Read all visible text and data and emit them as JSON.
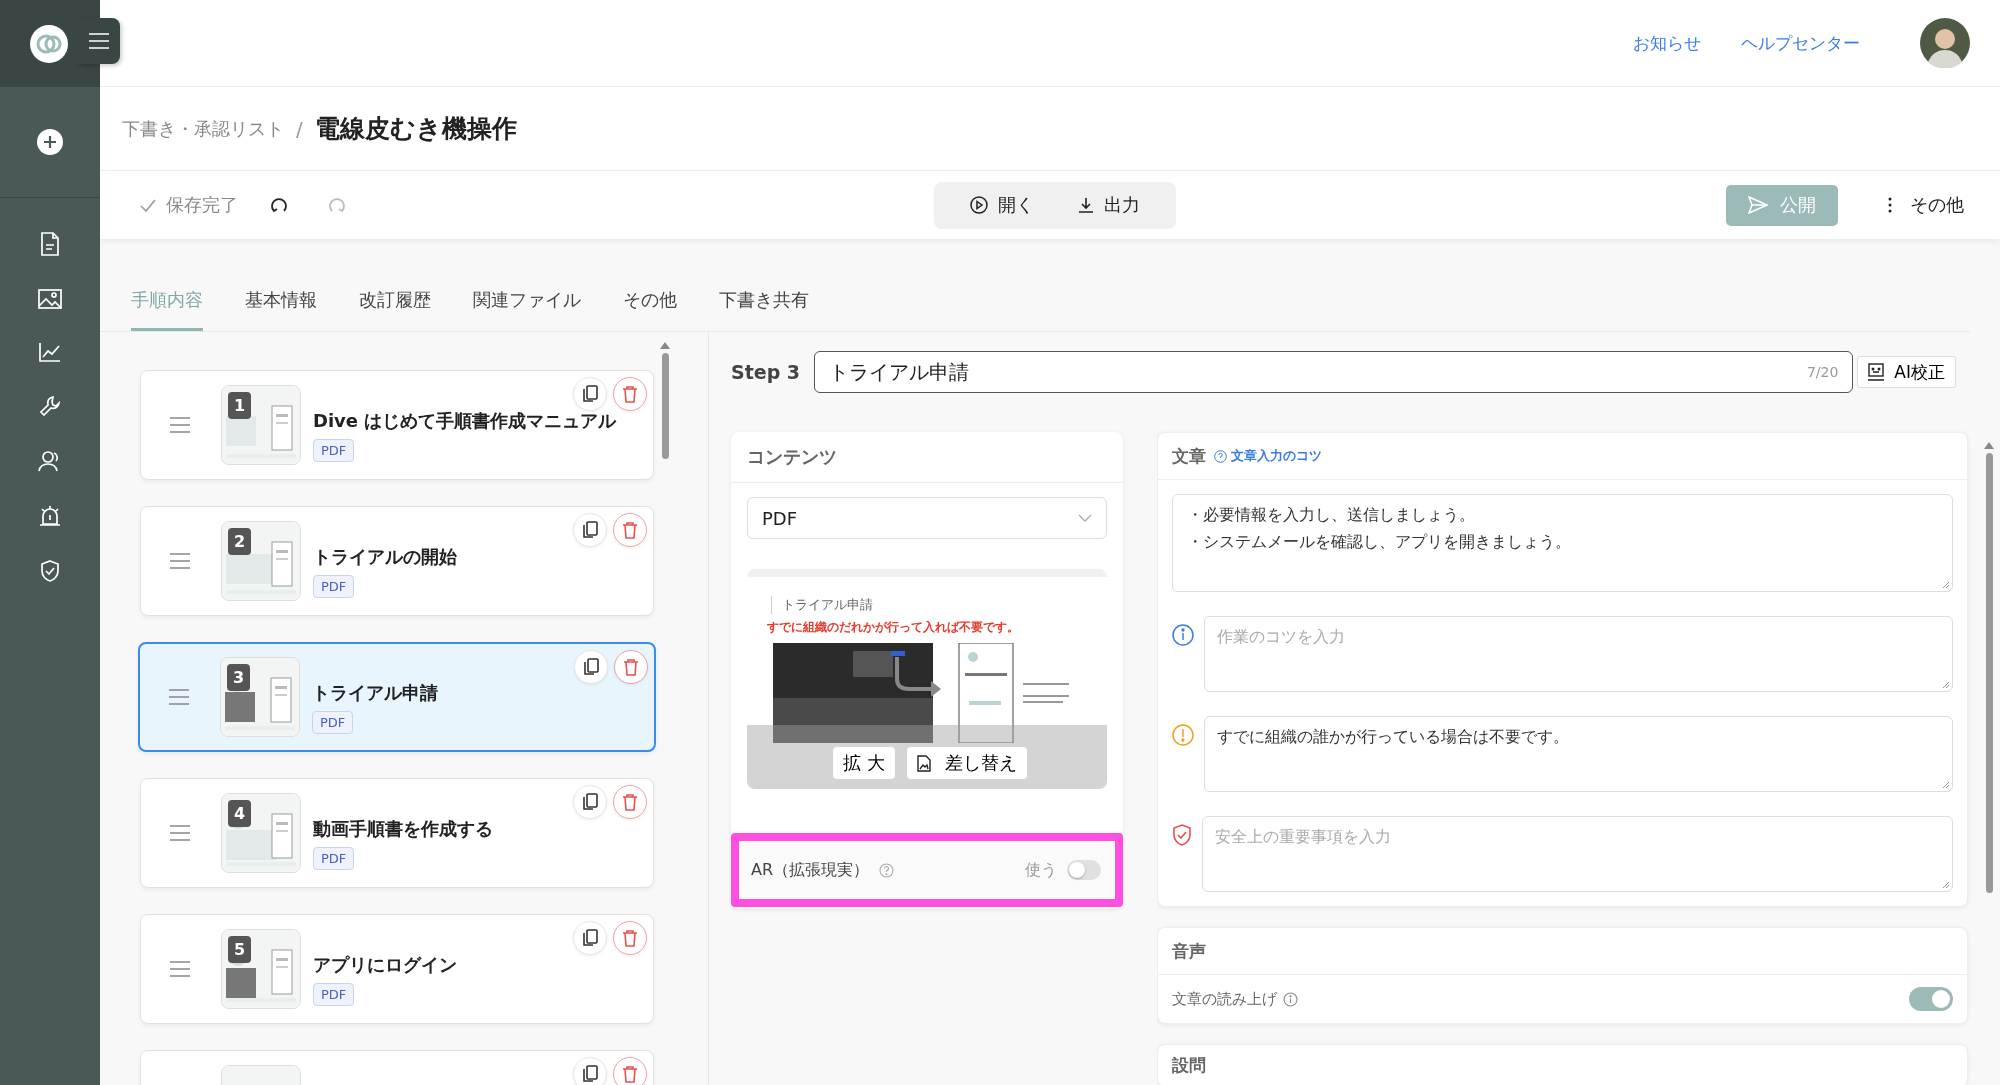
{
  "header": {
    "links": [
      "お知らせ",
      "ヘルプセンター"
    ]
  },
  "breadcrumb": {
    "parent": "下書き・承認リスト",
    "separator": "/",
    "title": "電線皮むき機操作"
  },
  "toolbar": {
    "save_status": "保存完了",
    "open": "開く",
    "export": "出力",
    "publish": "公開",
    "more": "その他"
  },
  "tabs": [
    {
      "label": "手順内容",
      "selected": true
    },
    {
      "label": "基本情報",
      "selected": false
    },
    {
      "label": "改訂履歴",
      "selected": false
    },
    {
      "label": "関連ファイル",
      "selected": false
    },
    {
      "label": "その他",
      "selected": false
    },
    {
      "label": "下書き共有",
      "selected": false
    }
  ],
  "steps": [
    {
      "number": "1",
      "title": "Dive はじめて手順書作成マニュアル",
      "tag": "PDF",
      "selected": false
    },
    {
      "number": "2",
      "title": "トライアルの開始",
      "tag": "PDF",
      "selected": false
    },
    {
      "number": "3",
      "title": "トライアル申請",
      "tag": "PDF",
      "selected": true
    },
    {
      "number": "4",
      "title": "動画手順書を作成する",
      "tag": "PDF",
      "selected": false
    },
    {
      "number": "5",
      "title": "アプリにログイン",
      "tag": "PDF",
      "selected": false
    },
    {
      "selected": false
    }
  ],
  "editor": {
    "step_label": "Step 3",
    "title": "トライアル申請",
    "counter": "7/20",
    "ai_button": "AI校正"
  },
  "content": {
    "heading": "コンテンツ",
    "type": "PDF",
    "preview": {
      "title": "トライアル申請",
      "note": "すでに組織のだれかが行って入れば不要です。"
    },
    "zoom_button": "拡 大",
    "replace_button": "差し替え",
    "ar": {
      "label": "AR（拡張現実）",
      "toggle_label": "使う",
      "on": false,
      "highlighted": true
    }
  },
  "text": {
    "heading": "文章",
    "tips_link": "文章入力のコツ",
    "body": [
      "・必要情報を入力し、送信しましょう。",
      "・システムメールを確認し、アプリを開きましょう。"
    ],
    "notes": [
      {
        "kind": "tip",
        "placeholder": "作業のコツを入力"
      },
      {
        "kind": "caution",
        "value": "すでに組織の誰かが行っている場合は不要です。"
      },
      {
        "kind": "safety",
        "placeholder": "安全上の重要事項を入力"
      }
    ]
  },
  "audio": {
    "heading": "音声",
    "read_aloud": "文章の読み上げ",
    "on": true
  },
  "questions": {
    "heading": "設問"
  }
}
